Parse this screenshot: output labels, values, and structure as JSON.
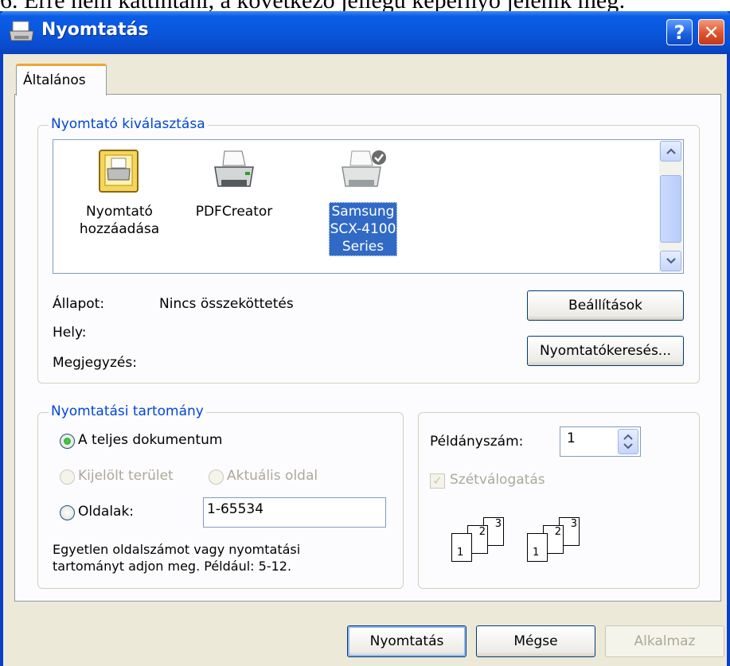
{
  "top_overflow_text": "6. Erre nem kattintani, a következő jellegű képernyő jelenik meg:",
  "window": {
    "title": "Nyomtatás",
    "help_label": "?",
    "close_label": "✕"
  },
  "tabs": [
    {
      "label": "Általános"
    }
  ],
  "printer_group": {
    "legend": "Nyomtató kiválasztása",
    "printers": [
      {
        "label_lines": [
          "Nyomtató",
          "hozzáadása"
        ],
        "icon": "add-printer-icon"
      },
      {
        "label_lines": [
          "PDFCreator"
        ],
        "icon": "printer-icon"
      },
      {
        "label_lines": [
          "Samsung",
          "SCX-4100",
          "Series"
        ],
        "icon": "default-printer-icon",
        "selected": true
      }
    ],
    "status_label": "Állapot:",
    "status_value": "Nincs összeköttetés",
    "location_label": "Hely:",
    "comment_label": "Megjegyzés:",
    "settings_button": "Beállítások",
    "find_button": "Nyomtatókeresés..."
  },
  "range_group": {
    "legend": "Nyomtatási tartomány",
    "all_label": "A teljes dokumentum",
    "selection_label": "Kijelölt terület",
    "current_label": "Aktuális oldal",
    "pages_label": "Oldalak:",
    "pages_value": "1-65534",
    "hint": "Egyetlen oldalszámot vagy nyomtatási tartományt adjon meg. Például: 5-12."
  },
  "copies_group": {
    "copies_label": "Példányszám:",
    "copies_value": "1",
    "collate_label": "Szétválogatás",
    "page_numbers": [
      "1",
      "2",
      "3"
    ]
  },
  "buttons": {
    "print": "Nyomtatás",
    "cancel": "Mégse",
    "apply": "Alkalmaz"
  },
  "colors": {
    "title_blue": "#0a57dd",
    "legend_blue": "#0046d5",
    "selection_blue": "#316ac5",
    "dialog_bg": "#ece9d8"
  }
}
